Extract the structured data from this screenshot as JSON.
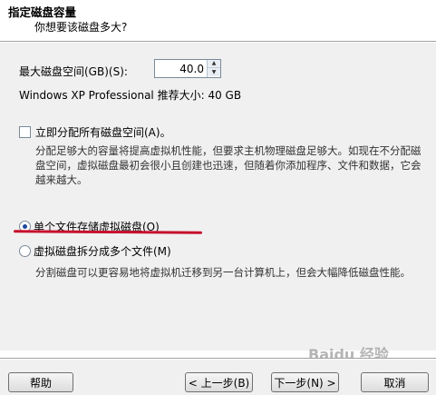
{
  "header": {
    "title": "指定磁盘容量",
    "subtitle": "你想要该磁盘多大?"
  },
  "disk": {
    "max_label": "最大磁盘空间(GB)(S):",
    "max_value": "40.0",
    "recommend": "Windows XP Professional 推荐大小: 40 GB"
  },
  "allocate": {
    "label": "立即分配所有磁盘空间(A)。",
    "checked": false,
    "description": "分配足够大的容量将提高虚拟机性能，但要求主机物理磁盘足够大。如现在不分配磁盘空间，虚拟磁盘最初会很小且创建也迅速，但随着你添加程序、文件和数据，它会越来越大。"
  },
  "storage": {
    "single_label": "单个文件存储虚拟磁盘(O)",
    "multi_label": "虚拟磁盘拆分成多个文件(M)",
    "multi_description": "分割磁盘可以更容易地将虚拟机迁移到另一台计算机上，但会大幅降低磁盘性能。",
    "selected": "single"
  },
  "buttons": {
    "help": "帮助",
    "back": "< 上一步(B)",
    "next": "下一步(N) >",
    "cancel": "取消"
  },
  "watermark": "Baidu 经验",
  "colors": {
    "annotation_underline": "#c8102e",
    "dialog_background": "#f0f0f0"
  }
}
